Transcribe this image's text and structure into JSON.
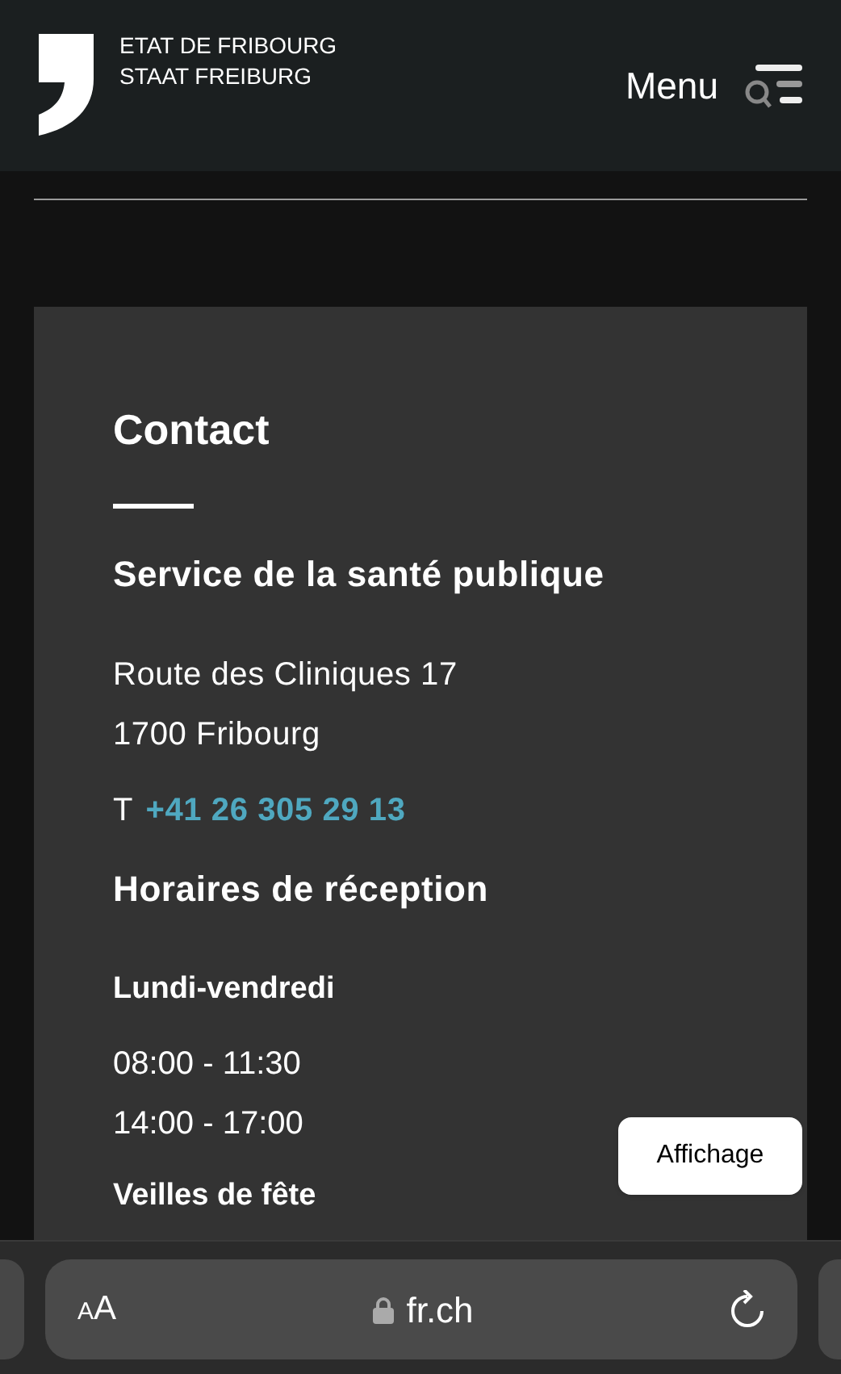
{
  "header": {
    "logo_lines": [
      "ETAT DE FRIBOURG",
      "STAAT FREIBURG"
    ],
    "menu_label": "Menu"
  },
  "contact": {
    "title": "Contact",
    "service": "Service de la santé publique",
    "address": [
      "Route des Cliniques 17",
      "1700 Fribourg"
    ],
    "phone_prefix": "T",
    "phone": "+41 26 305 29 13",
    "hours_title": "Horaires de réception",
    "hours": [
      {
        "days": "Lundi-vendredi",
        "times": [
          "08:00 - 11:30",
          "14:00 - 17:00"
        ]
      },
      {
        "days": "Veilles de fête"
      }
    ]
  },
  "display_button": "Affichage",
  "browser": {
    "text_size": "AA",
    "url": "fr.ch"
  }
}
